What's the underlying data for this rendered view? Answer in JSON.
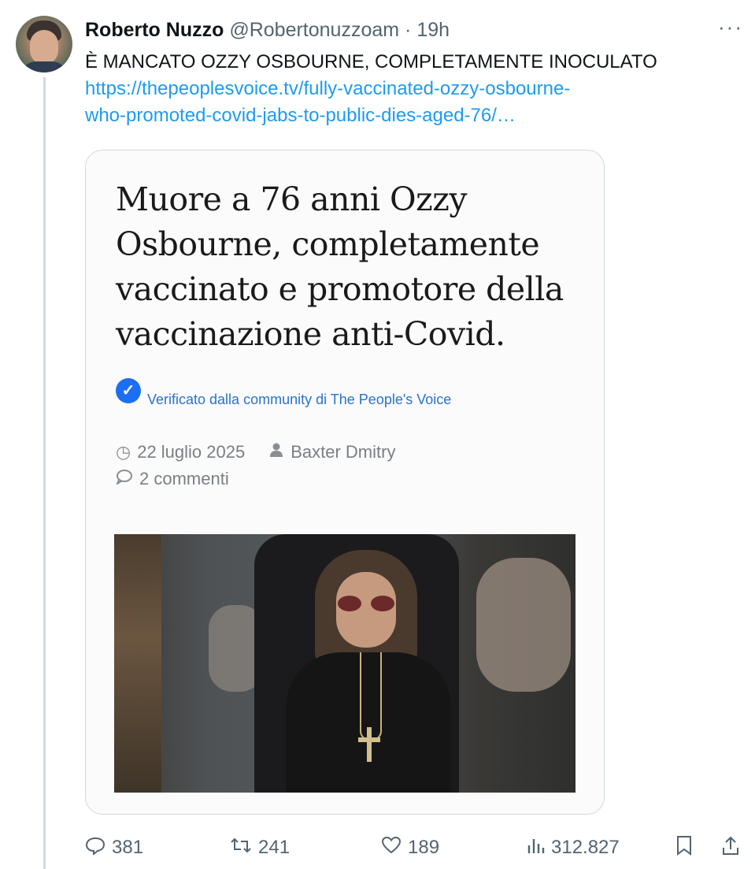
{
  "tweet": {
    "author_name": "Roberto Nuzzo",
    "author_handle": "@Robertonuzzoam",
    "separator": "·",
    "time": "19h",
    "more_label": "···",
    "text": "È MANCATO OZZY OSBOURNE, COMPLETAMENTE INOCULATO",
    "link_line1": "https://thepeoplesvoice.tv/fully-vaccinated-ozzy-osbourne-",
    "link_line2": "who-promoted-covid-jabs-to-public-dies-aged-76/…"
  },
  "card": {
    "headline": "Muore a 76 anni Ozzy Osbourne, completamente vaccinato e promotore della vaccinazione anti-Covid.",
    "verified_text": "Verificato dalla community di The People's Voice",
    "date": "22 luglio 2025",
    "author": "Baxter Dmitry",
    "comments": "2 commenti"
  },
  "actions": {
    "replies": "381",
    "retweets": "241",
    "likes": "189",
    "views": "312.827"
  },
  "colors": {
    "link": "#1d9bf0",
    "secondary": "#536471",
    "verified_badge": "#1d6ff2"
  },
  "icons": [
    "more-icon",
    "verified-check-icon",
    "clock-icon",
    "person-icon",
    "comment-icon",
    "reply-icon",
    "retweet-icon",
    "like-icon",
    "views-icon",
    "bookmark-icon",
    "share-icon"
  ]
}
